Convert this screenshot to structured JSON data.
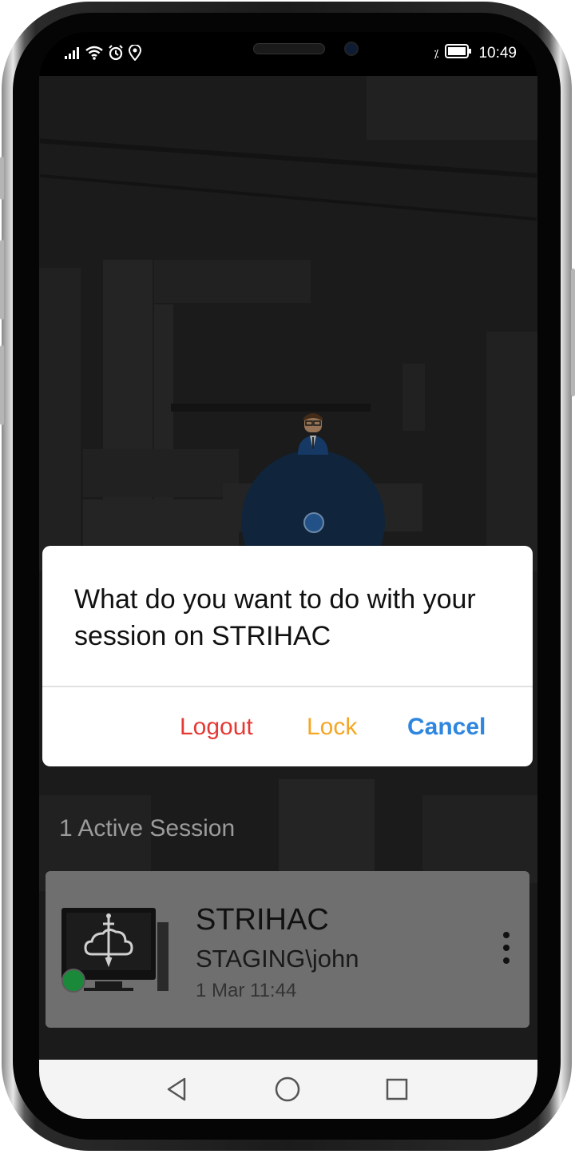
{
  "status_bar": {
    "time": "10:49",
    "nfc_glyph": "⁒",
    "icons": [
      "signal-icon",
      "wifi-icon",
      "alarm-icon",
      "location-icon",
      "battery-icon"
    ]
  },
  "dialog": {
    "message": "What do you want to do with your session on STRIHAC",
    "buttons": {
      "logout": "Logout",
      "lock": "Lock",
      "cancel": "Cancel"
    },
    "colors": {
      "logout": "#e53935",
      "lock": "#f5a623",
      "cancel": "#2e86de"
    }
  },
  "sessions": {
    "header": "1 Active Session",
    "items": [
      {
        "name": "STRIHAC",
        "user": "STAGING\\john",
        "time": "1 Mar 11:44",
        "status_color": "#1a8a3a"
      }
    ]
  },
  "nav": {
    "icons": [
      "back-icon",
      "home-icon",
      "recents-icon"
    ]
  }
}
